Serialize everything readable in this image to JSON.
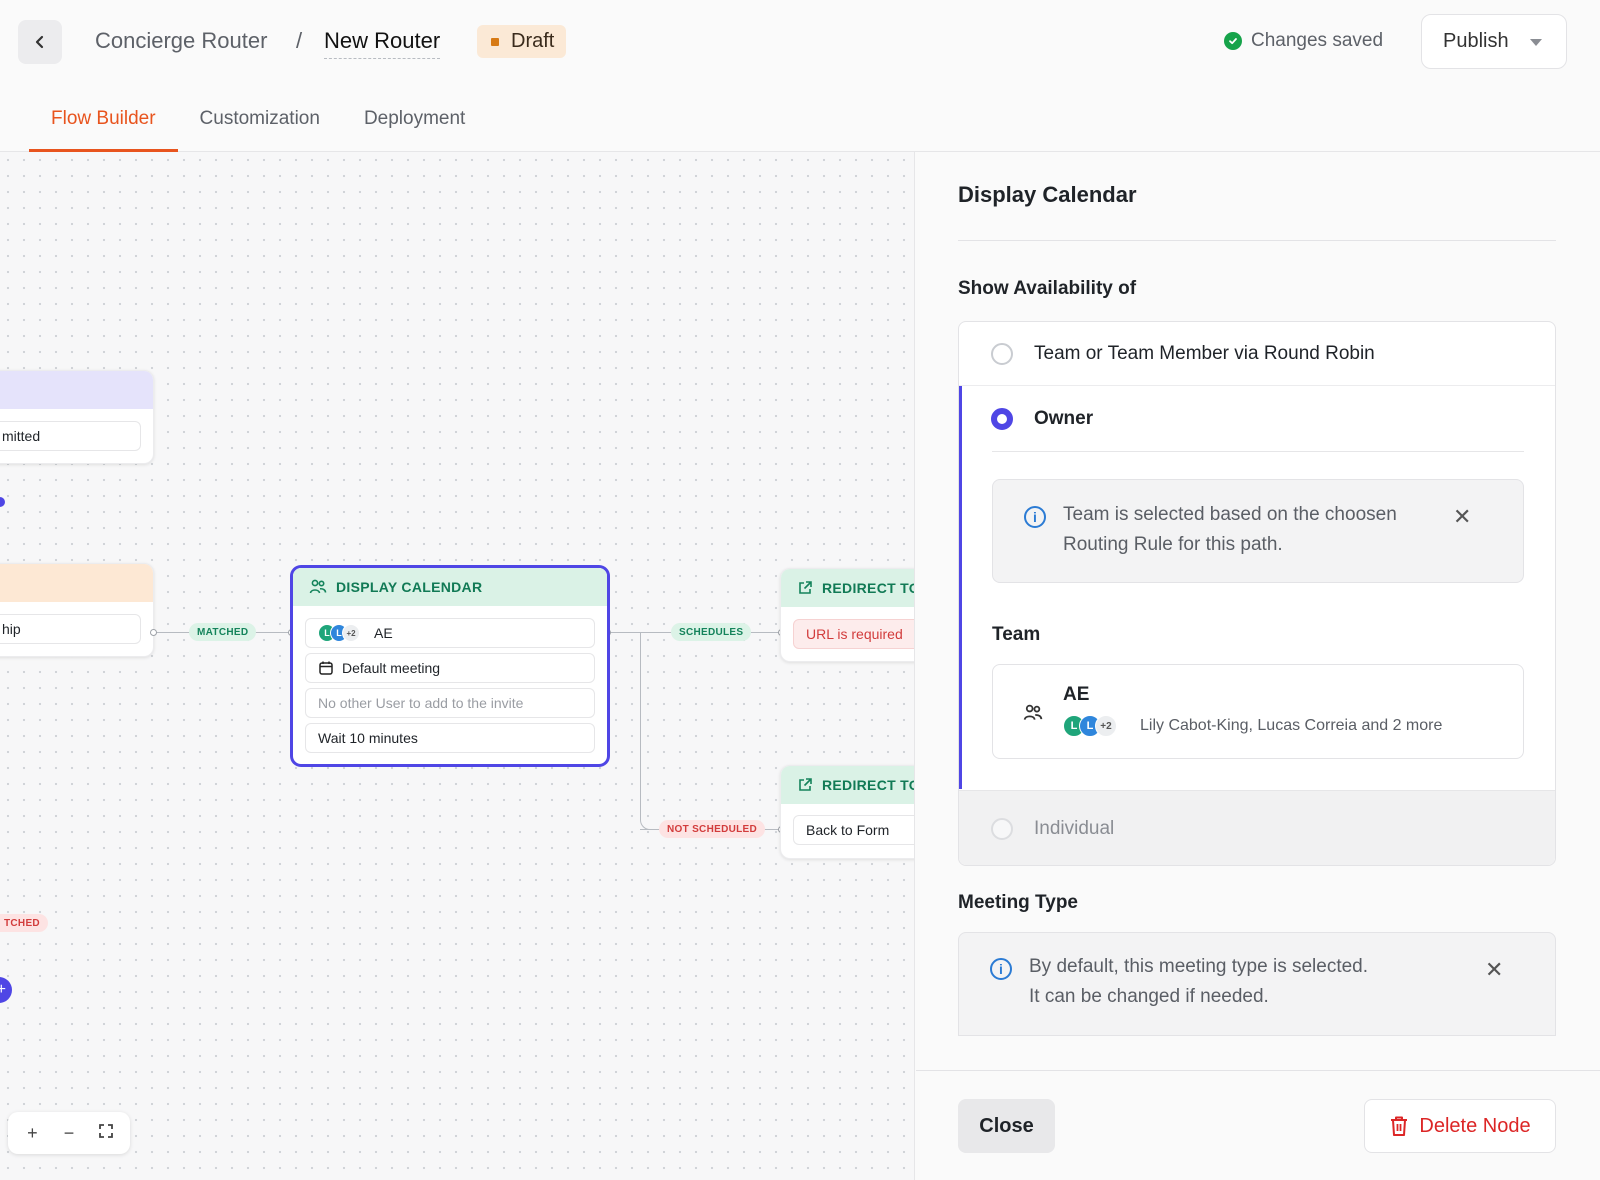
{
  "header": {
    "breadcrumb_parent": "Concierge Router",
    "breadcrumb_separator": "/",
    "breadcrumb_current": "New Router",
    "status_badge": "Draft",
    "save_status": "Changes saved",
    "publish_label": "Publish"
  },
  "tabs": [
    {
      "label": "Flow Builder",
      "active": true
    },
    {
      "label": "Customization",
      "active": false
    },
    {
      "label": "Deployment",
      "active": false
    }
  ],
  "canvas": {
    "partial_node_top": {
      "row_text": "mitted"
    },
    "partial_node_mid": {
      "row_text": "hip"
    },
    "display_node": {
      "title": "DISPLAY CALENDAR",
      "team": {
        "avatars": [
          "L",
          "L"
        ],
        "more": "+2",
        "name": "AE"
      },
      "meeting": "Default meeting",
      "other_users_placeholder": "No other User to add to the invite",
      "wait": "Wait 10 minutes"
    },
    "redirect_top": {
      "title": "REDIRECT TO",
      "row_text": "URL is required"
    },
    "redirect_bottom": {
      "title": "REDIRECT TO",
      "row_text": "Back to Form"
    },
    "edge_labels": {
      "matched": "MATCHED",
      "schedules": "SCHEDULES",
      "not_scheduled": "NOT SCHEDULED",
      "partial_unmatched": "TCHED"
    },
    "zoom_controls": {
      "zoom_in": "+",
      "zoom_out": "−"
    }
  },
  "panel": {
    "title": "Display Calendar",
    "availability_label": "Show Availability of",
    "options": [
      {
        "label": "Team or Team Member via Round Robin",
        "selected": false
      },
      {
        "label": "Owner",
        "selected": true
      },
      {
        "label": "Individual",
        "selected": false
      }
    ],
    "owner_info": "Team is selected based on the choosen Routing Rule for this path.",
    "team_label": "Team",
    "team": {
      "name": "AE",
      "avatars": [
        "L",
        "L"
      ],
      "more": "+2",
      "members": "Lily Cabot-King, Lucas Correia and 2 more"
    },
    "meeting_type_label": "Meeting Type",
    "meeting_info_line1": "By default, this meeting type is selected.",
    "meeting_info_line2": "It can be changed if needed.",
    "close_label": "Close",
    "delete_label": "Delete Node"
  },
  "colors": {
    "accent": "#e8541e",
    "selection": "#4f46e5",
    "success": "#16a34a",
    "danger": "#dc2626",
    "node_header_green": "#dcf3e7"
  }
}
